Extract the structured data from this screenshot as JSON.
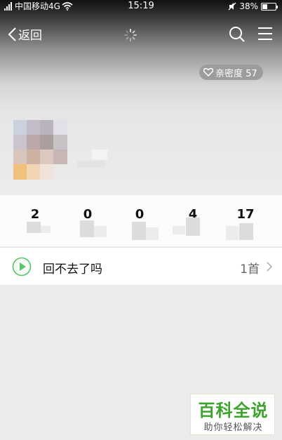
{
  "status_bar": {
    "carrier": "中国移动4G",
    "time": "15:19",
    "battery": "38%",
    "battery_level": 0.38,
    "icons": [
      "signal-icon",
      "wifi-icon",
      "mute-icon",
      "battery-icon"
    ]
  },
  "nav": {
    "back_label": "返回",
    "icons": [
      "back-chevron-icon",
      "loading-spinner-icon",
      "search-icon",
      "menu-icon"
    ]
  },
  "profile": {
    "intimacy_label": "亲密度 57",
    "intimacy_icon": "heart-icon"
  },
  "stats": {
    "values": [
      "2",
      "0",
      "0",
      "4",
      "17"
    ]
  },
  "song_row": {
    "title": "回不去了吗",
    "count": "1首",
    "icons": [
      "play-icon",
      "chevron-right-icon"
    ]
  },
  "watermark": {
    "title": "百科全说",
    "subtitle": "助你轻松解决"
  },
  "colors": {
    "accent_green": "#3aa52a",
    "play_green": "#5cc46a",
    "badge_gray": "#9c9c9c"
  }
}
